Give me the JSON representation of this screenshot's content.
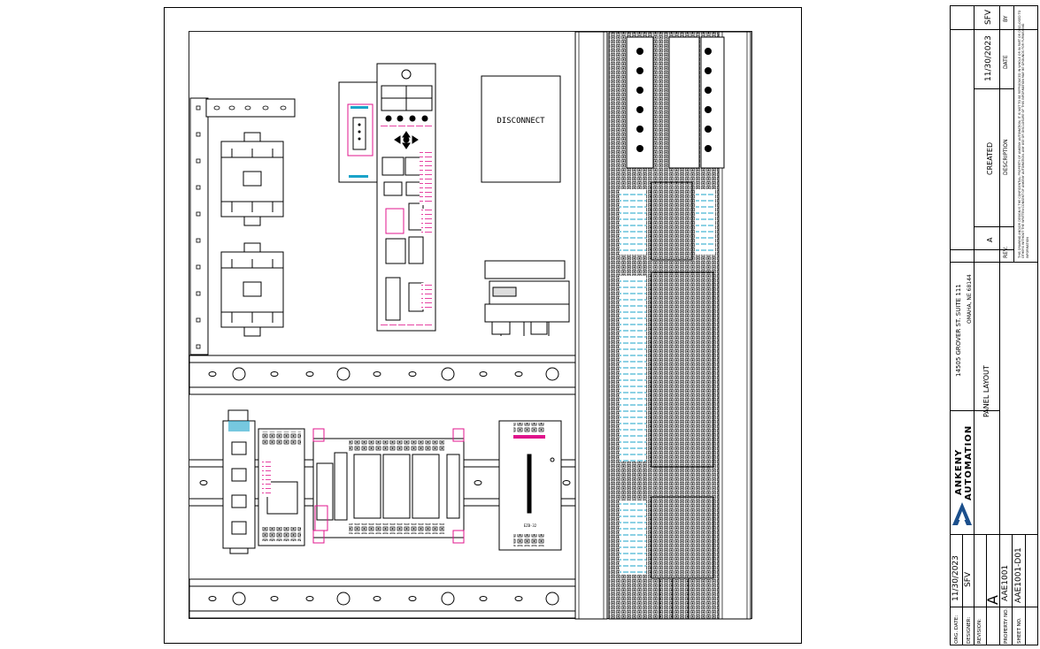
{
  "drawing": {
    "disconnect_label": "DISCONNECT",
    "plc_card_label": "EZB-32"
  },
  "title_block": {
    "address_line1": "14505 GROVER ST. SUITE 111",
    "address_line2": "OMAHA, NE 68144",
    "company_line1": "ANKENY",
    "company_line2": "AUTOMATION",
    "drawing_title": "PANEL LAYOUT",
    "notice": "THIS DRAWING AND/OR DESIGN IS THE CONFIDENTIAL PROPERTY OF ANKENY AUTOMATION, IT IS NOT TO BE REPRODUCED IN WHOLE OR IN PART OR DISCLOSED TO OTHERS WITHOUT THE WRITTEN CONSENT OF ANKENY AUTOMATION. ANY USE OR DISCLOSURE OF THIS INFORMATION MAY BE GROUNDS FOR FURNISHING INFORMATION",
    "revision_table": {
      "rev_header": "REV.",
      "description_header": "DESCRIPTION",
      "date_header": "DATE",
      "by_header": "BY",
      "rows": [
        {
          "rev": "A",
          "description": "CREATED",
          "date": "11/30/2023",
          "by": "SFV"
        }
      ]
    },
    "fields": {
      "org_date_label": "ORG. DATE:",
      "org_date": "11/30/2023",
      "designer_label": "DESIGNER:",
      "designer": "SFV",
      "revision_label": "REVISION:",
      "revision": "A",
      "property_no_label": "PROPERTY NO.",
      "property_no": "AAE1001",
      "sheet_no_label": "SHEET NO.",
      "sheet_no": "AAE1001-D01"
    }
  }
}
